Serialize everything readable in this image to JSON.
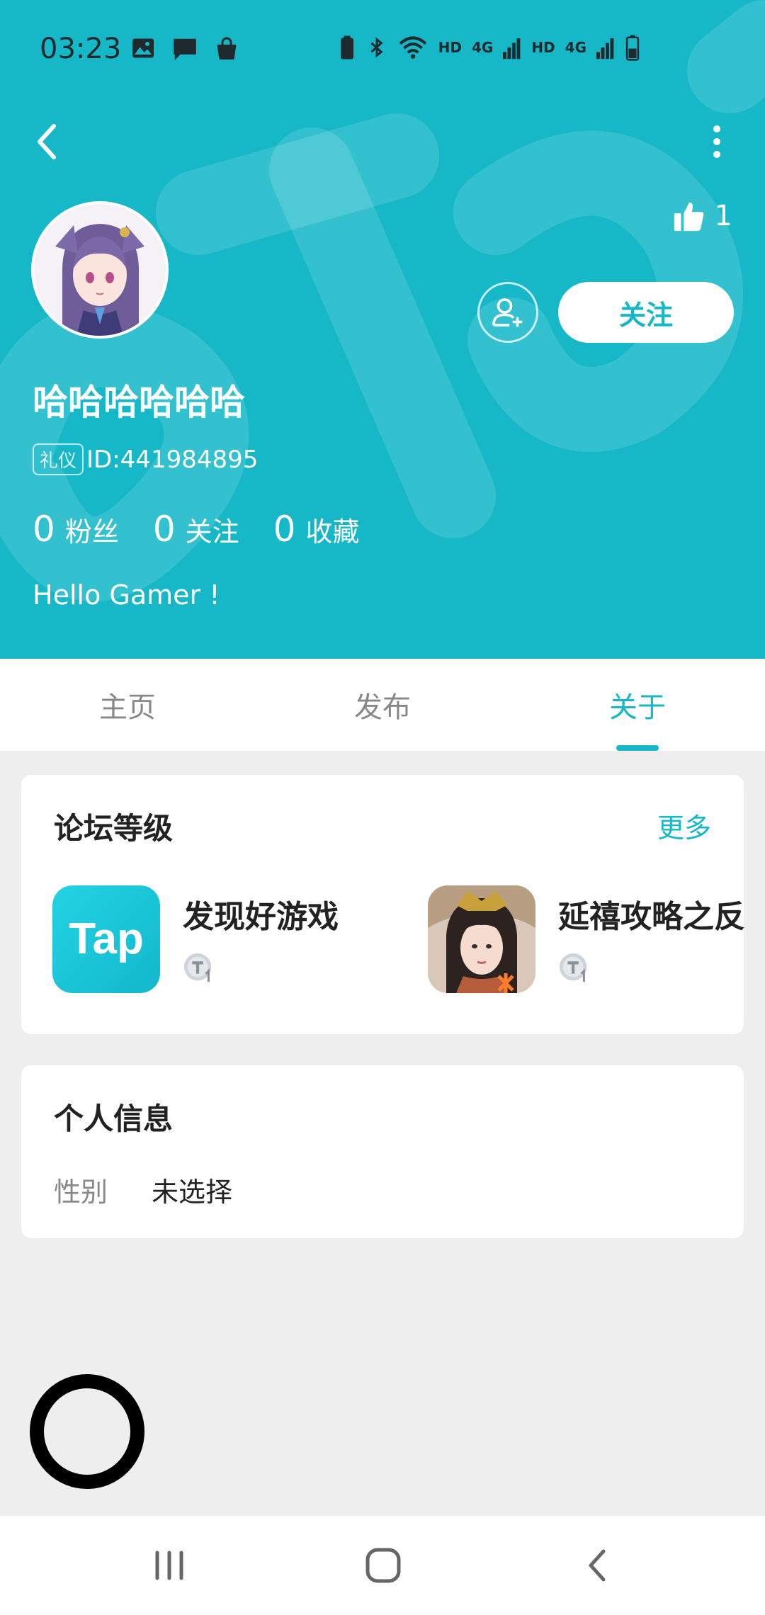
{
  "colors": {
    "accent": "#16b8c8",
    "background": "#eeeeee"
  },
  "status_bar": {
    "time": "03:23",
    "network_labels": [
      "HD",
      "4G",
      "HD",
      "4G"
    ]
  },
  "profile": {
    "like_count": "1",
    "follow_label": "关注",
    "username": "哈哈哈哈哈哈",
    "id_tag": "礼仪",
    "id_text": "ID:441984895",
    "stats": [
      {
        "value": "0",
        "label": "粉丝"
      },
      {
        "value": "0",
        "label": "关注"
      },
      {
        "value": "0",
        "label": "收藏"
      }
    ],
    "bio": "Hello Gamer !"
  },
  "tabs": [
    {
      "label": "主页",
      "active": false
    },
    {
      "label": "发布",
      "active": false
    },
    {
      "label": "关于",
      "active": true
    }
  ],
  "forum_card": {
    "title": "论坛等级",
    "more_label": "更多",
    "games": [
      {
        "name": "发现好游戏",
        "icon": "tap-logo"
      },
      {
        "name": "延禧攻略之反",
        "icon": "game-portrait"
      }
    ]
  },
  "info_card": {
    "title": "个人信息",
    "rows": [
      {
        "label": "性别",
        "value": "未选择"
      }
    ]
  },
  "icons": {
    "back": "back-arrow-icon",
    "more": "more-vertical-icon",
    "like": "thumbs-up-icon",
    "add_friend": "add-user-icon",
    "nav_recent": "recent-apps-icon",
    "nav_home": "home-icon",
    "nav_back": "nav-back-icon"
  }
}
